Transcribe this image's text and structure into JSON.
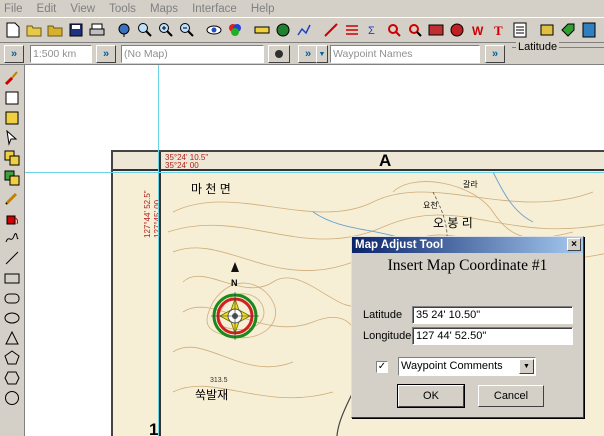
{
  "menu": [
    "File",
    "Edit",
    "View",
    "Tools",
    "Maps",
    "Interface",
    "Help"
  ],
  "toolbar2": {
    "scale_value": "1:500 km",
    "map_value": "(No Map)",
    "waypoint_field": "Waypoint Names",
    "latitude_label": "Latitude"
  },
  "map": {
    "sheet_letter": "A",
    "corner_lat_1": "35°24' 10.5\"",
    "corner_lat_2": "35°24' 00",
    "corner_lon_1": "127°44' 52.5\"",
    "corner_lon_2": "127°45' 00",
    "place_1": "마 천 면",
    "place_2": "오 봉 리",
    "place_3": "쑥발재",
    "place_4": "갈라",
    "place_5": "요천",
    "compass_n": "N",
    "sheet_number": "1",
    "elevation": "313.5"
  },
  "dialog": {
    "title": "Map Adjust Tool",
    "close_glyph": "×",
    "heading": "Insert Map Coordinate #1",
    "latitude_label": "Latitude",
    "latitude_value": "35 24' 10.50\"",
    "longitude_label": "Longitude",
    "longitude_value": "127 44' 52.50\"",
    "check_glyph": "✓",
    "dropdown_value": "Waypoint Comments",
    "ok_label": "OK",
    "cancel_label": "Cancel"
  },
  "colors": {
    "title_bar": "#0a246a",
    "crosshair": "#6ad4e6",
    "map_paper": "#f6eed5"
  }
}
